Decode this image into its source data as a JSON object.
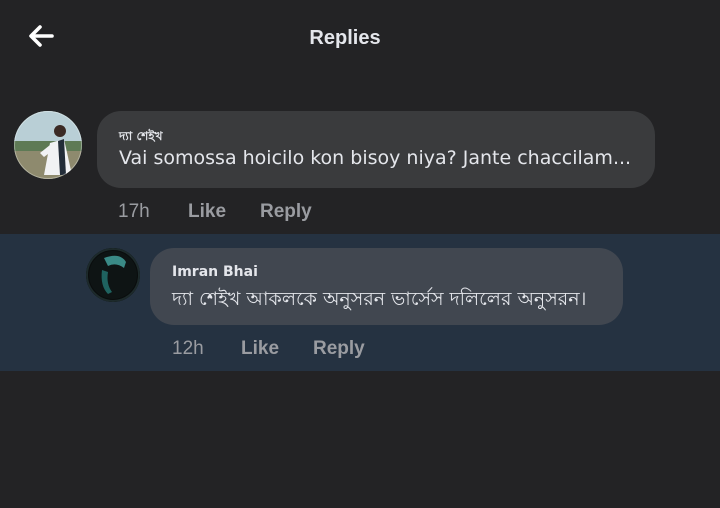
{
  "header": {
    "back_icon": "arrow-left-icon",
    "title": "Replies"
  },
  "comments": [
    {
      "author": "দ্যা শেইখ",
      "text": "Vai somossa hoicilo kon bisoy niya? Jante chaccilam...",
      "time": "17h",
      "like_label": "Like",
      "reply_label": "Reply"
    },
    {
      "author": "Imran Bhai",
      "text": "দ্যা শেইখ আকলকে অনুসরন ভার্সেস দলিলের অনুসরন।",
      "time": "12h",
      "like_label": "Like",
      "reply_label": "Reply"
    }
  ],
  "colors": {
    "background": "#232325",
    "highlight_row": "#253241",
    "bubble": "#3a3b3d",
    "text_primary": "#e4e6eb",
    "text_secondary": "#9a9ca1"
  }
}
